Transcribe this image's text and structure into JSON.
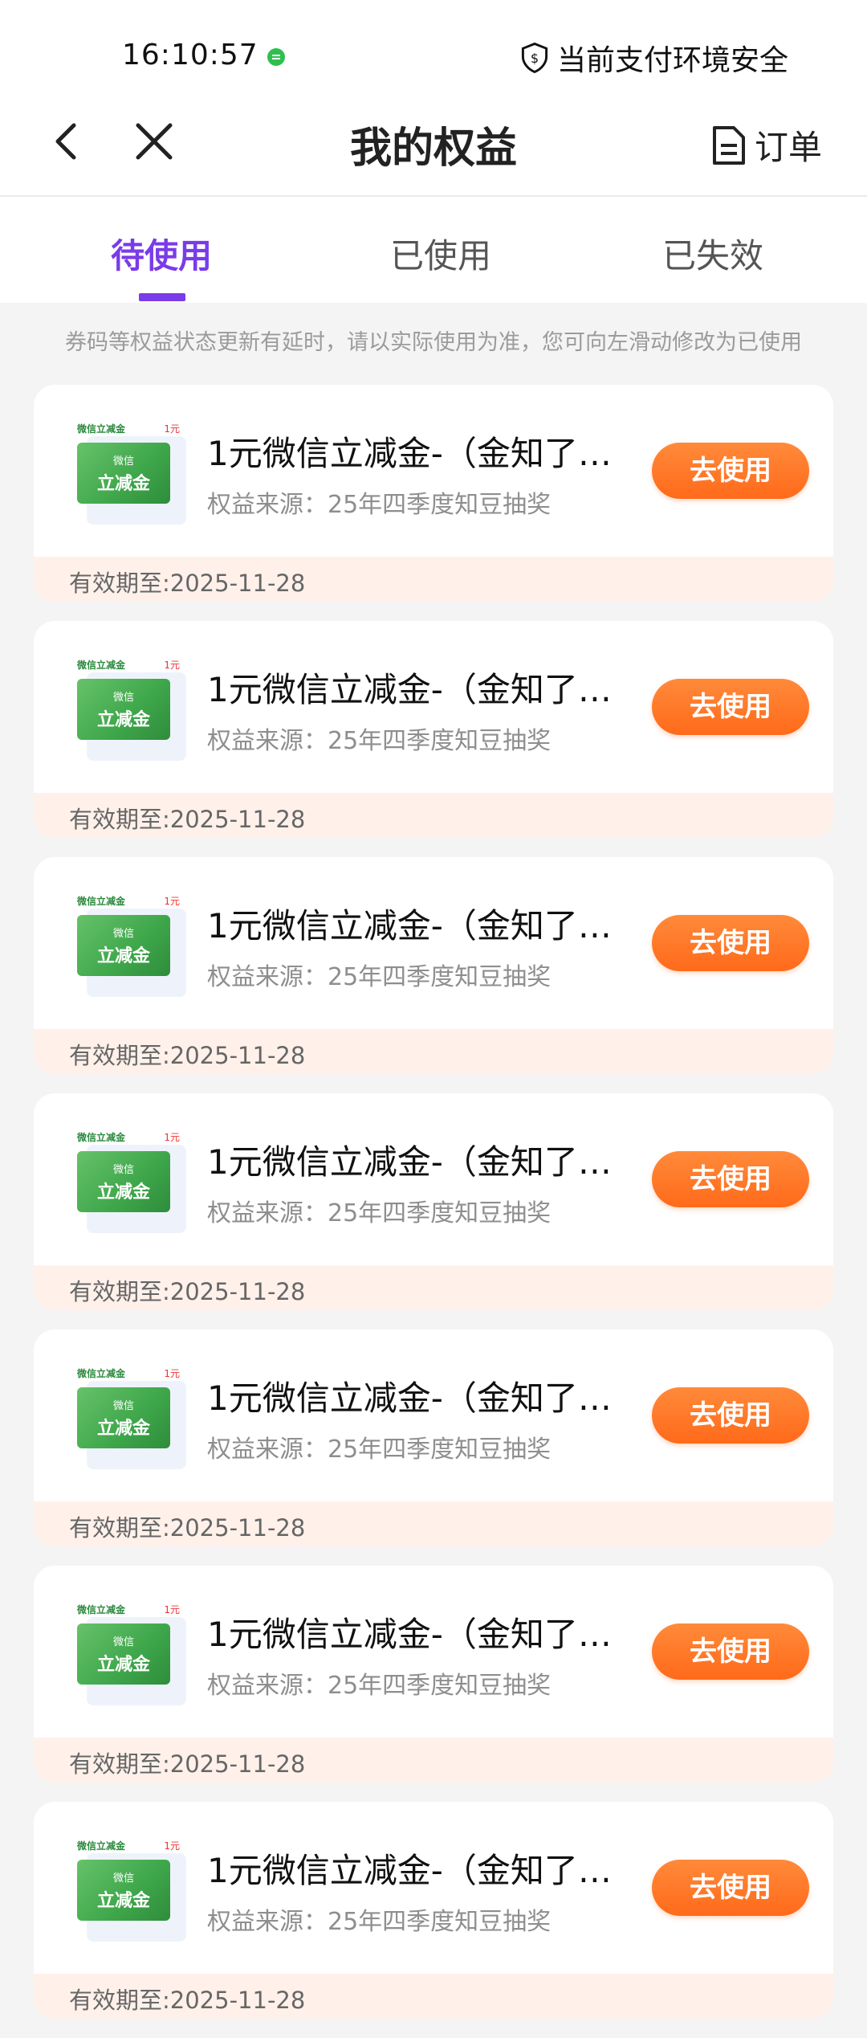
{
  "status_bar": {
    "time": "16:10:57",
    "secure_text": "当前支付环境安全"
  },
  "nav": {
    "title": "我的权益",
    "orders_label": "订单"
  },
  "tabs": [
    {
      "label": "待使用",
      "active": true
    },
    {
      "label": "已使用",
      "active": false
    },
    {
      "label": "已失效",
      "active": false
    }
  ],
  "notice": "券码等权益状态更新有延时，请以实际使用为准，您可向左滑动修改为已使用",
  "thumb": {
    "top_label": "微信立减金",
    "price_label": "1元",
    "face_small": "微信",
    "face_large": "立减金"
  },
  "coupons": [
    {
      "title": "1元微信立减金-（金知了…",
      "source": "权益来源：25年四季度知豆抽奖",
      "button": "去使用",
      "validity": "有效期至:2025-11-28"
    },
    {
      "title": "1元微信立减金-（金知了…",
      "source": "权益来源：25年四季度知豆抽奖",
      "button": "去使用",
      "validity": "有效期至:2025-11-28"
    },
    {
      "title": "1元微信立减金-（金知了…",
      "source": "权益来源：25年四季度知豆抽奖",
      "button": "去使用",
      "validity": "有效期至:2025-11-28"
    },
    {
      "title": "1元微信立减金-（金知了…",
      "source": "权益来源：25年四季度知豆抽奖",
      "button": "去使用",
      "validity": "有效期至:2025-11-28"
    },
    {
      "title": "1元微信立减金-（金知了…",
      "source": "权益来源：25年四季度知豆抽奖",
      "button": "去使用",
      "validity": "有效期至:2025-11-28"
    },
    {
      "title": "1元微信立减金-（金知了…",
      "source": "权益来源：25年四季度知豆抽奖",
      "button": "去使用",
      "validity": "有效期至:2025-11-28"
    },
    {
      "title": "1元微信立减金-（金知了…",
      "source": "权益来源：25年四季度知豆抽奖",
      "button": "去使用",
      "validity": "有效期至:2025-11-28"
    }
  ],
  "colors": {
    "accent": "#7a3be8",
    "button": "#ff6a1a",
    "validity_bg": "#fff1ea"
  }
}
